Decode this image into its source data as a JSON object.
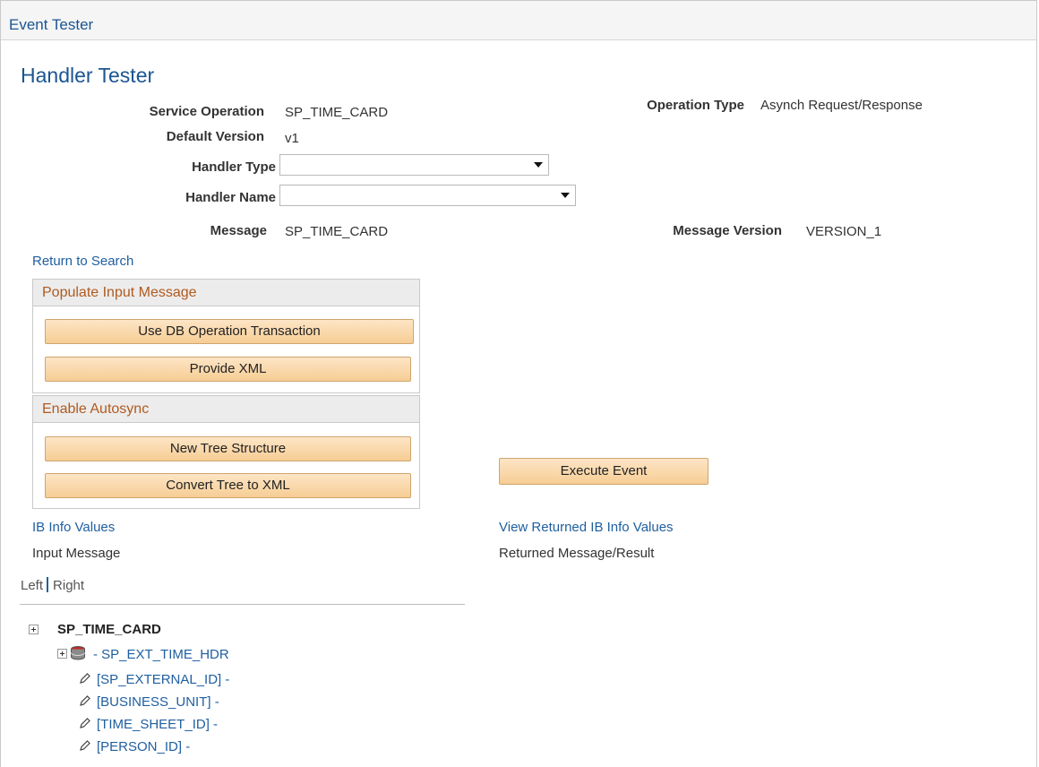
{
  "window": {
    "title": "Event Tester"
  },
  "page": {
    "title": "Handler Tester"
  },
  "form": {
    "service_operation_label": "Service Operation",
    "service_operation_value": "SP_TIME_CARD",
    "operation_type_label": "Operation Type",
    "operation_type_value": "Asynch Request/Response",
    "default_version_label": "Default Version",
    "default_version_value": "v1",
    "handler_type_label": "Handler Type",
    "handler_type_value": "",
    "handler_name_label": "Handler Name",
    "handler_name_value": "",
    "message_label": "Message",
    "message_value": "SP_TIME_CARD",
    "message_version_label": "Message Version",
    "message_version_value": "VERSION_1"
  },
  "links": {
    "return_to_search": "Return to Search",
    "ib_info_values": "IB Info Values",
    "view_returned_ib_info_values": "View Returned IB Info Values"
  },
  "populate_group": {
    "title": "Populate Input Message",
    "use_db_button": "Use DB Operation Transaction",
    "provide_xml_button": "Provide XML"
  },
  "autosync_group": {
    "title": "Enable Autosync",
    "new_tree_button": "New Tree Structure",
    "convert_tree_button": "Convert Tree to XML"
  },
  "execute_button": "Execute Event",
  "labels": {
    "input_message": "Input Message",
    "returned_message": "Returned Message/Result"
  },
  "toggle": {
    "left": "Left",
    "right": "Right",
    "active": "left"
  },
  "tree": {
    "root": "SP_TIME_CARD",
    "record": "- SP_EXT_TIME_HDR",
    "fields": [
      "[SP_EXTERNAL_ID] -",
      "[BUSINESS_UNIT] -",
      "[TIME_SHEET_ID] -",
      "[PERSON_ID] -"
    ]
  },
  "colors": {
    "title_blue": "#1b5592",
    "link_blue": "#1f5fa0",
    "group_header_text": "#b05a1f",
    "button_fill": "#f6cd94"
  },
  "icons": {
    "expand": "plus-box-icon",
    "record": "database-icon",
    "field": "pencil-icon"
  }
}
